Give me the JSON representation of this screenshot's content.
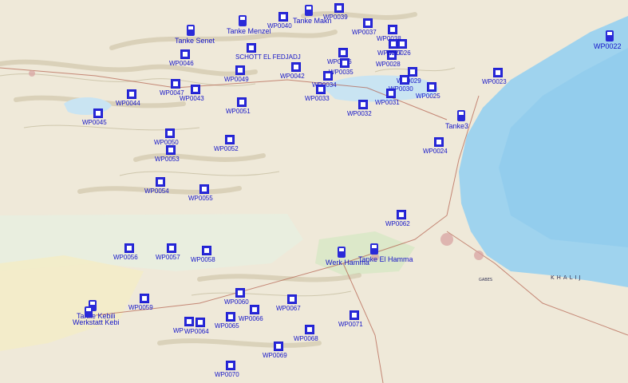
{
  "map": {
    "colors": {
      "land": "#efe9d9",
      "sea": "#9fd3ee",
      "sea_deep": "#7fc3ea",
      "salt_lake": "#c9e4f2",
      "waypoint": "#2a2ad8",
      "label": "#1414c8",
      "relief": "#c9c1a2",
      "vegetation": "#b7d39a"
    },
    "sea_labels": [
      "GABES",
      "KHALIJ"
    ],
    "waypoints": [
      {
        "label": "WP0039",
        "icon": "waypoint-icon"
      },
      {
        "label": "WP0040",
        "icon": "waypoint-icon"
      },
      {
        "label": "WP0037",
        "icon": "waypoint-icon"
      },
      {
        "label": "WP0046",
        "icon": "waypoint-icon"
      },
      {
        "label": "SCHOTT EL FEDJADJ",
        "icon": "waypoint-icon"
      },
      {
        "label": "WP0036",
        "icon": "waypoint-icon"
      },
      {
        "label": "WP0035",
        "icon": "waypoint-icon"
      },
      {
        "label": "WP0028",
        "icon": "waypoint-icon"
      },
      {
        "label": "WP0026",
        "icon": "waypoint-icon"
      },
      {
        "label": "WP0029",
        "icon": "waypoint-icon"
      },
      {
        "label": "WP0030",
        "icon": "waypoint-icon"
      },
      {
        "label": "WP0025",
        "icon": "waypoint-icon"
      },
      {
        "label": "WP0023",
        "icon": "waypoint-icon"
      },
      {
        "label": "WP0022",
        "icon": "fuel-pump-icon"
      },
      {
        "label": "WP0042",
        "icon": "waypoint-icon"
      },
      {
        "label": "WP0049",
        "icon": "waypoint-icon"
      },
      {
        "label": "WP0034",
        "icon": "waypoint-icon"
      },
      {
        "label": "WP0033",
        "icon": "waypoint-icon"
      },
      {
        "label": "WP0031",
        "icon": "waypoint-icon"
      },
      {
        "label": "WP0032",
        "icon": "waypoint-icon"
      },
      {
        "label": "WP0047",
        "icon": "waypoint-icon"
      },
      {
        "label": "WP0043",
        "icon": "waypoint-icon"
      },
      {
        "label": "WP0044",
        "icon": "waypoint-icon"
      },
      {
        "label": "WP0045",
        "icon": "waypoint-icon"
      },
      {
        "label": "WP0051",
        "icon": "waypoint-icon"
      },
      {
        "label": "WP0050",
        "icon": "waypoint-icon"
      },
      {
        "label": "WP0053",
        "icon": "waypoint-icon"
      },
      {
        "label": "WP0052",
        "icon": "waypoint-icon"
      },
      {
        "label": "WP0054",
        "icon": "waypoint-icon"
      },
      {
        "label": "WP0055",
        "icon": "waypoint-icon"
      },
      {
        "label": "Tanke3",
        "icon": "fuel-pump-icon"
      },
      {
        "label": "WP0024",
        "icon": "waypoint-icon"
      },
      {
        "label": "WP0062",
        "icon": "waypoint-icon"
      },
      {
        "label": "WP0056",
        "icon": "waypoint-icon"
      },
      {
        "label": "WP0057",
        "icon": "waypoint-icon"
      },
      {
        "label": "WP0058",
        "icon": "waypoint-icon"
      },
      {
        "label": "Tanke El Hamma",
        "icon": "fuel-pump-icon"
      },
      {
        "label": "Werk Hamma",
        "icon": "fuel-pump-icon"
      },
      {
        "label": "WP0059",
        "icon": "waypoint-icon"
      },
      {
        "label": "WP0060",
        "icon": "waypoint-icon"
      },
      {
        "label": "WP0066",
        "icon": "waypoint-icon"
      },
      {
        "label": "WP0067",
        "icon": "waypoint-icon"
      },
      {
        "label": "WP0065",
        "icon": "waypoint-icon"
      },
      {
        "label": "WP0064",
        "icon": "waypoint-icon"
      },
      {
        "label": "WP",
        "icon": "waypoint-icon"
      },
      {
        "label": "WP0068",
        "icon": "waypoint-icon"
      },
      {
        "label": "WP0071",
        "icon": "waypoint-icon"
      },
      {
        "label": "WP0069",
        "icon": "waypoint-icon"
      },
      {
        "label": "WP0070",
        "icon": "waypoint-icon"
      },
      {
        "label": "Tanke Kebili",
        "icon": "fuel-pump-icon"
      },
      {
        "label": "Werkstatt Kebi",
        "icon": "fuel-pump-icon"
      },
      {
        "label": "Tanke Senet",
        "icon": "fuel-pump-icon"
      },
      {
        "label": "Tanke Menzel",
        "icon": "fuel-pump-icon"
      },
      {
        "label": "Tanke Makn",
        "icon": "fuel-pump-icon"
      },
      {
        "label": "WP0038",
        "icon": "waypoint-icon"
      },
      {
        "label": "WP0027",
        "icon": "waypoint-icon"
      }
    ]
  }
}
